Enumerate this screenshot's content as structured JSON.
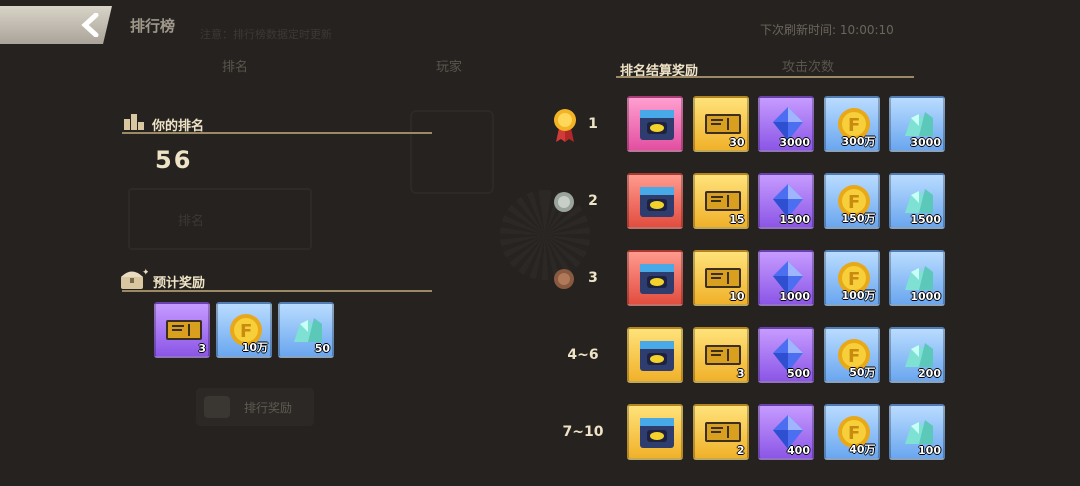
{
  "header": {
    "title": "排行榜",
    "subtitle": "注意：排行榜数据定时更新",
    "refresh_label": "下次刷新时间:",
    "refresh_time": "10:00:10"
  },
  "tabs": [
    "排名",
    "玩家",
    "攻击次数"
  ],
  "my_rank": {
    "heading": "你的排名",
    "value": "56",
    "ghost_label": "排名"
  },
  "expected_reward": {
    "heading": "预计奖励",
    "items": [
      {
        "icon": "ticket-icon",
        "qty": "3",
        "rarity": "purple"
      },
      {
        "icon": "coin-icon",
        "qty": "10万",
        "rarity": "blue"
      },
      {
        "icon": "crystal-icon",
        "qty": "50",
        "rarity": "blue"
      }
    ],
    "button_label": "排行奖励"
  },
  "settlement": {
    "heading": "排名结算奖励",
    "rows": [
      {
        "rank": "1",
        "medal": "gold",
        "items": [
          {
            "icon": "chest-icon",
            "qty": "",
            "rarity": "pink"
          },
          {
            "icon": "ticket-icon",
            "qty": "30",
            "rarity": "gold"
          },
          {
            "icon": "gem-icon",
            "qty": "3000",
            "rarity": "purple"
          },
          {
            "icon": "coin-icon",
            "qty": "300万",
            "rarity": "blue"
          },
          {
            "icon": "crystal-icon",
            "qty": "3000",
            "rarity": "blue"
          }
        ]
      },
      {
        "rank": "2",
        "medal": "silver",
        "items": [
          {
            "icon": "chest-icon",
            "qty": "",
            "rarity": "red"
          },
          {
            "icon": "ticket-icon",
            "qty": "15",
            "rarity": "gold"
          },
          {
            "icon": "gem-icon",
            "qty": "1500",
            "rarity": "purple"
          },
          {
            "icon": "coin-icon",
            "qty": "150万",
            "rarity": "blue"
          },
          {
            "icon": "crystal-icon",
            "qty": "1500",
            "rarity": "blue"
          }
        ]
      },
      {
        "rank": "3",
        "medal": "bronze",
        "items": [
          {
            "icon": "chest-icon",
            "qty": "",
            "rarity": "red"
          },
          {
            "icon": "ticket-icon",
            "qty": "10",
            "rarity": "gold"
          },
          {
            "icon": "gem-icon",
            "qty": "1000",
            "rarity": "purple"
          },
          {
            "icon": "coin-icon",
            "qty": "100万",
            "rarity": "blue"
          },
          {
            "icon": "crystal-icon",
            "qty": "1000",
            "rarity": "blue"
          }
        ]
      },
      {
        "rank": "4~6",
        "medal": "",
        "items": [
          {
            "icon": "chest-icon",
            "qty": "",
            "rarity": "gold"
          },
          {
            "icon": "ticket-icon",
            "qty": "3",
            "rarity": "gold"
          },
          {
            "icon": "gem-icon",
            "qty": "500",
            "rarity": "purple"
          },
          {
            "icon": "coin-icon",
            "qty": "50万",
            "rarity": "blue"
          },
          {
            "icon": "crystal-icon",
            "qty": "200",
            "rarity": "blue"
          }
        ]
      },
      {
        "rank": "7~10",
        "medal": "",
        "items": [
          {
            "icon": "chest-icon",
            "qty": "",
            "rarity": "gold"
          },
          {
            "icon": "ticket-icon",
            "qty": "2",
            "rarity": "gold"
          },
          {
            "icon": "gem-icon",
            "qty": "400",
            "rarity": "purple"
          },
          {
            "icon": "coin-icon",
            "qty": "40万",
            "rarity": "blue"
          },
          {
            "icon": "crystal-icon",
            "qty": "100",
            "rarity": "blue"
          }
        ]
      }
    ]
  }
}
